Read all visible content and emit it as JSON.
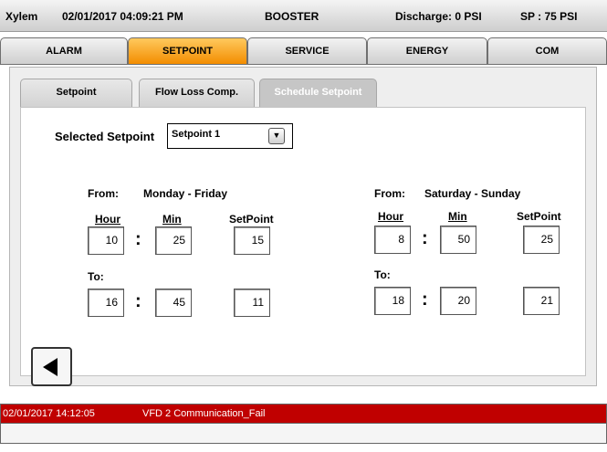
{
  "header": {
    "brand": "Xylem",
    "datetime": "02/01/2017 04:09:21 PM",
    "mode": "BOOSTER",
    "discharge": "Discharge: 0 PSI",
    "setpoint": "SP : 75 PSI"
  },
  "main_tabs": [
    {
      "label": "ALARM",
      "active": false
    },
    {
      "label": "SETPOINT",
      "active": true
    },
    {
      "label": "SERVICE",
      "active": false
    },
    {
      "label": "ENERGY",
      "active": false
    },
    {
      "label": "COM",
      "active": false
    }
  ],
  "sub_tabs": [
    {
      "label": "Setpoint",
      "active": false
    },
    {
      "label": "Flow Loss Comp.",
      "active": false
    },
    {
      "label": "Schedule Setpoint",
      "active": true
    }
  ],
  "selector": {
    "label": "Selected Setpoint",
    "value": "Setpoint 1"
  },
  "labels": {
    "from": "From:",
    "to": "To:",
    "hour": "Hour",
    "min": "Min",
    "setpoint": "SetPoint",
    "colon": ":"
  },
  "weekday": {
    "range": "Monday - Friday",
    "from": {
      "hour": "10",
      "min": "25",
      "setpoint": "15"
    },
    "to": {
      "hour": "16",
      "min": "45",
      "setpoint": "11"
    }
  },
  "weekend": {
    "range": "Saturday - Sunday",
    "from": {
      "hour": "8",
      "min": "50",
      "setpoint": "25"
    },
    "to": {
      "hour": "18",
      "min": "20",
      "setpoint": "21"
    }
  },
  "alarm": {
    "timestamp": "02/01/2017 14:12:05",
    "message": "VFD 2 Communication_Fail",
    "color": "#c00000"
  },
  "colors": {
    "active_tab": "#f39a10",
    "header_bg": "#dcdcdc"
  }
}
